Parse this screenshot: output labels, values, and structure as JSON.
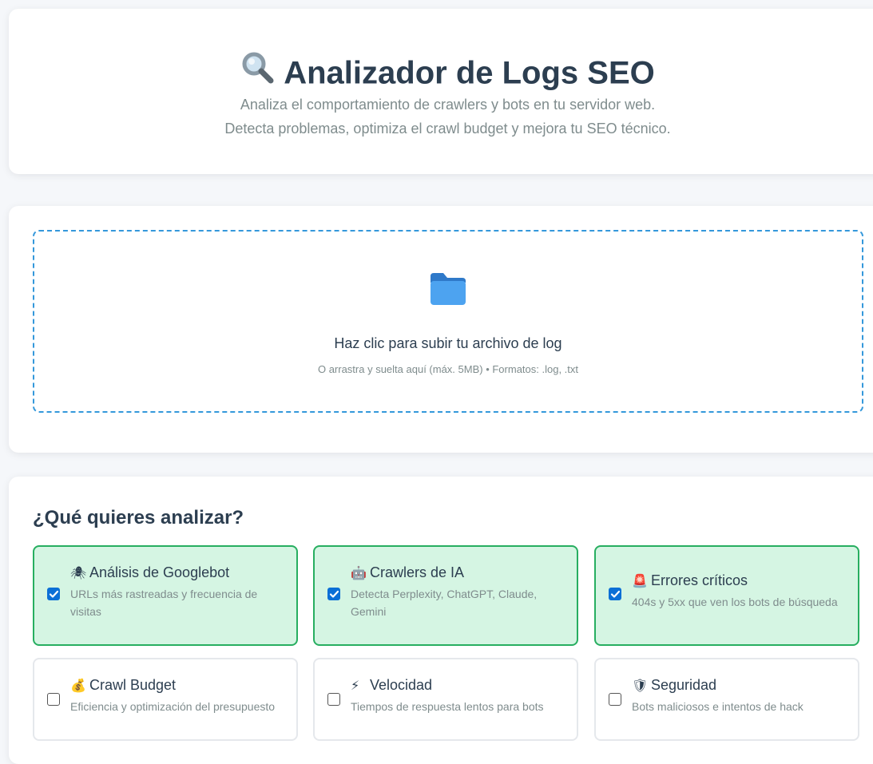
{
  "header": {
    "title": "Analizador de Logs SEO",
    "title_icon": "magnifier-icon",
    "subtitle_line1": "Analiza el comportamiento de crawlers y bots en tu servidor web.",
    "subtitle_line2": "Detecta problemas, optimiza el crawl budget y mejora tu SEO técnico."
  },
  "upload": {
    "icon": "folder-icon",
    "main_text": "Haz clic para subir tu archivo de log",
    "hint": "O arrastra y suelta aquí (máx. 5MB) • Formatos: .log, .txt"
  },
  "options": {
    "heading": "¿Qué quieres analizar?",
    "items": [
      {
        "emoji": "🕷",
        "icon": "spider-icon",
        "title": "Análisis de Googlebot",
        "desc": "URLs más rastreadas y frecuencia de visitas",
        "checked": true
      },
      {
        "emoji": "🤖",
        "icon": "robot-icon",
        "title": "Crawlers de IA",
        "desc": "Detecta Perplexity, ChatGPT, Claude, Gemini",
        "checked": true
      },
      {
        "emoji": "🚨",
        "icon": "siren-icon",
        "title": "Errores críticos",
        "desc": "404s y 5xx que ven los bots de búsqueda",
        "checked": true
      },
      {
        "emoji": "💰",
        "icon": "money-bag-icon",
        "title": "Crawl Budget",
        "desc": "Eficiencia y optimización del presupuesto",
        "checked": false
      },
      {
        "emoji": "⚡",
        "icon": "lightning-icon",
        "title": "Velocidad",
        "desc": "Tiempos de respuesta lentos para bots",
        "checked": false
      },
      {
        "emoji": "🛡",
        "icon": "shield-icon",
        "title": "Seguridad",
        "desc": "Bots maliciosos e intentos de hack",
        "checked": false
      }
    ]
  },
  "colors": {
    "title": "#2c3e50",
    "muted": "#7f8c8d",
    "accent": "#3498db",
    "selected_bg": "#d5f5e3",
    "selected_border": "#27ae60",
    "checkbox": "#0b6fd6"
  }
}
